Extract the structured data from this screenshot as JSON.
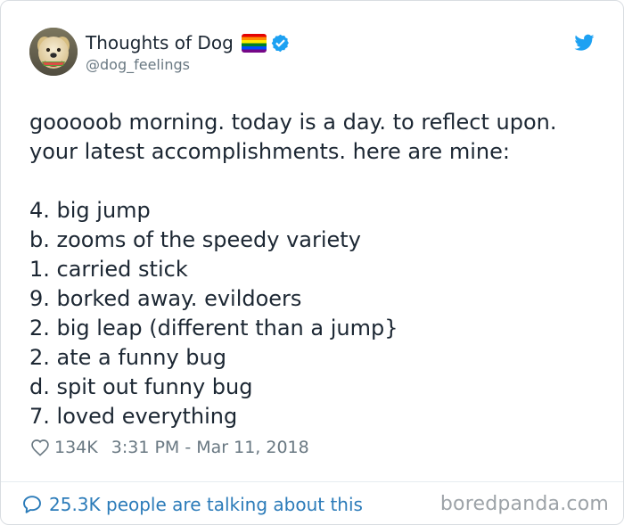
{
  "tweet": {
    "author": {
      "display_name": "Thoughts of Dog",
      "handle": "@dog_feelings"
    },
    "text": {
      "paragraph_lines": [
        "gooooob morning. today is a day. to reflect upon.",
        "your latest accomplishments. here are mine:"
      ],
      "list_lines": [
        "4. big jump",
        "b. zooms of the speedy variety",
        "1. carried stick",
        "9. borked away. evildoers",
        "2. big leap (different than a jump}",
        "2. ate a funny bug",
        "d. spit out funny bug",
        "7. loved everything"
      ]
    },
    "meta": {
      "likes": "134K",
      "timestamp": "3:31 PM - Mar 11, 2018"
    },
    "footer": {
      "conversation_text": "25.3K people are talking about this"
    }
  },
  "watermark": {
    "text": "boredpanda.com"
  },
  "icons": {
    "twitter": "twitter-bird-icon",
    "verified": "verified-badge-icon",
    "pride_flag": "rainbow-flag-icon",
    "heart": "heart-icon",
    "conversation": "speech-bubble-icon"
  },
  "colors": {
    "twitter_blue": "#1da1f2",
    "link_blue": "#2b7bb9",
    "text_dark": "#1c2733",
    "text_secondary": "#697882",
    "watermark_gray": "#9da3a8"
  }
}
